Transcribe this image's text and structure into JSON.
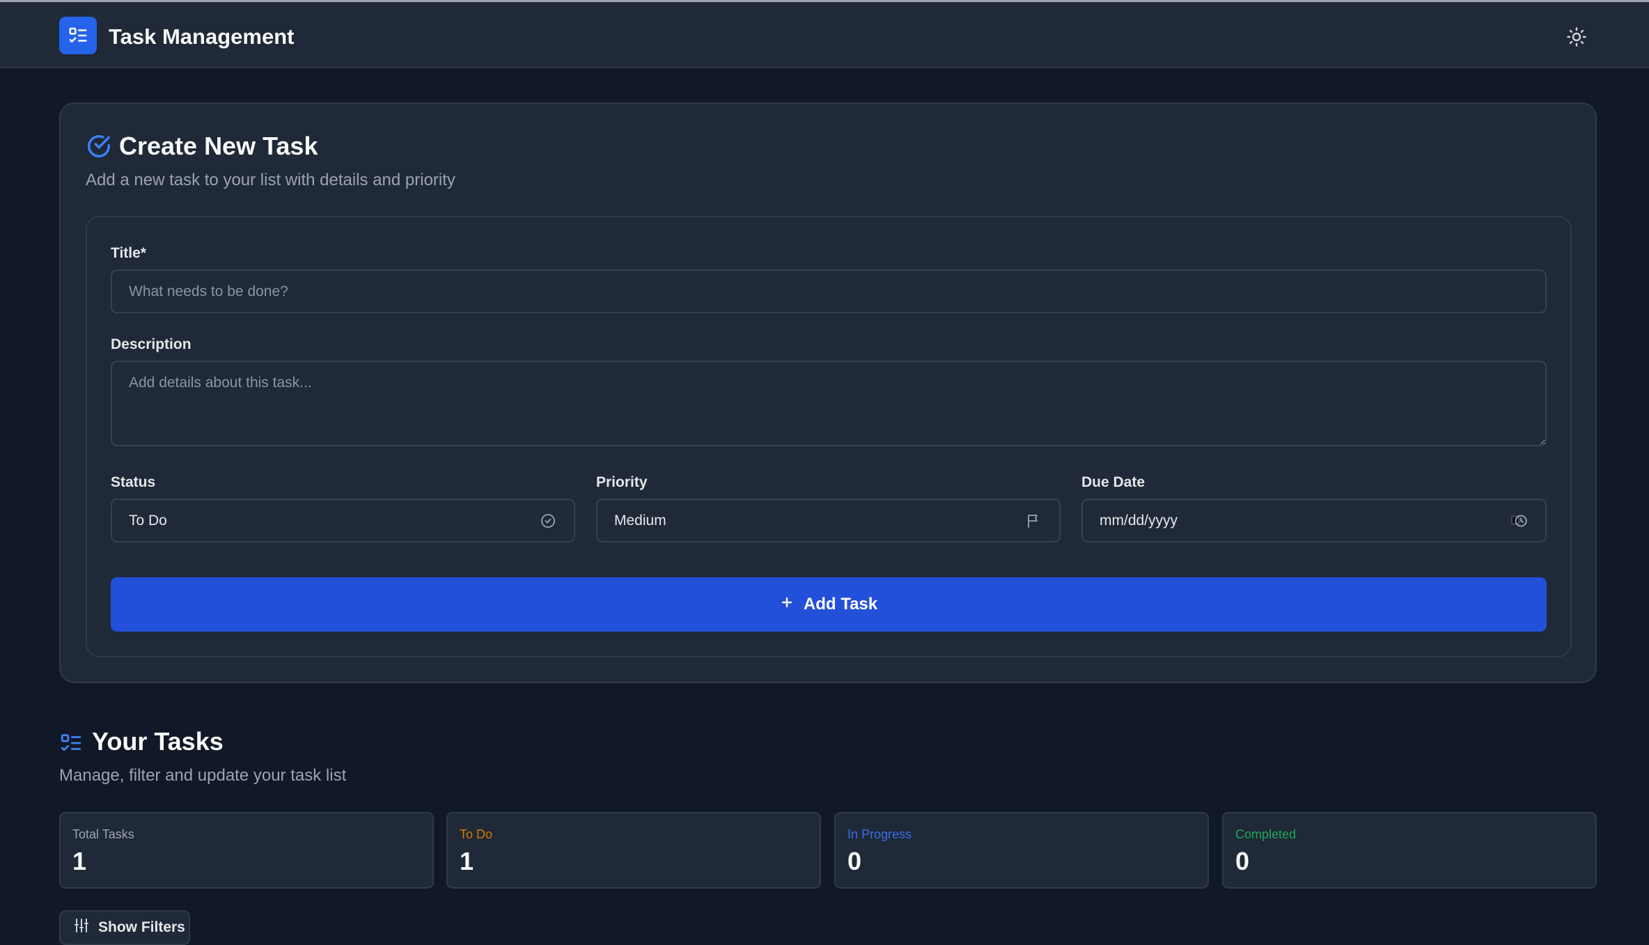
{
  "header": {
    "app_title": "Task Management",
    "logo_icon": "checklist-icon",
    "theme_icon": "sun-icon"
  },
  "create_task": {
    "title": "Create New Task",
    "subtitle": "Add a new task to your list with details and priority",
    "title_icon": "check-circle-icon",
    "fields": {
      "title_label": "Title*",
      "title_placeholder": "What needs to be done?",
      "title_value": "",
      "description_label": "Description",
      "description_placeholder": "Add details about this task...",
      "description_value": "",
      "status_label": "Status",
      "status_value": "To Do",
      "status_icon": "check-circle-icon",
      "priority_label": "Priority",
      "priority_value": "Medium",
      "priority_icon": "flag-icon",
      "due_date_label": "Due Date",
      "due_date_value": "mm/dd/yyyy",
      "due_date_icon": "calendar-clock-icon"
    },
    "add_button_label": "Add Task",
    "add_button_icon": "plus-icon"
  },
  "tasks": {
    "title": "Your Tasks",
    "subtitle": "Manage, filter and update your task list",
    "title_icon": "checklist-icon",
    "stats": [
      {
        "label": "Total Tasks",
        "value": "1",
        "color": "#9ca3af"
      },
      {
        "label": "To Do",
        "value": "1",
        "color": "#d97706"
      },
      {
        "label": "In Progress",
        "value": "0",
        "color": "#3b6fe6"
      },
      {
        "label": "Completed",
        "value": "0",
        "color": "#22a55a"
      }
    ],
    "filters_button_label": "Show Filters",
    "filters_icon": "sliders-icon"
  },
  "colors": {
    "background": "#111827",
    "surface": "#1f2937",
    "accent": "#2563eb",
    "button": "#2350d8"
  }
}
